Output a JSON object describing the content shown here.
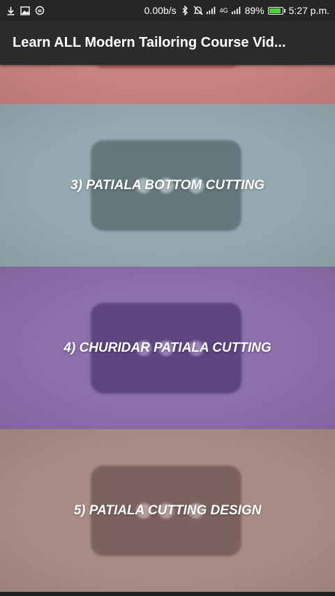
{
  "status_bar": {
    "network_speed": "0.00b/s",
    "network_type": "4G",
    "battery_percent": "89%",
    "battery_level": 0.89,
    "time": "5:27 p.m.",
    "icons": [
      "download-icon",
      "image-icon",
      "sync-icon",
      "bluetooth-icon",
      "mute-icon",
      "signal-icon"
    ]
  },
  "app_bar": {
    "title": "Learn ALL Modern Tailoring Course Vid..."
  },
  "videos": [
    {
      "label": "",
      "bg": "#c98380",
      "thumb": "#b05e5e",
      "dot": "#d9a3a0"
    },
    {
      "label": "3) PATIALA BOTTOM CUTTING",
      "bg": "#94aab0",
      "thumb": "#64777c",
      "dot": "#a7b8bc"
    },
    {
      "label": "4) CHURIDAR PATIALA CUTTING",
      "bg": "#8c6fab",
      "thumb": "#5c4581",
      "dot": "#9c84b9"
    },
    {
      "label": "5) PATIALA CUTTING DESIGN",
      "bg": "#a98c86",
      "thumb": "#7c625e",
      "dot": "#b59f9a"
    }
  ]
}
